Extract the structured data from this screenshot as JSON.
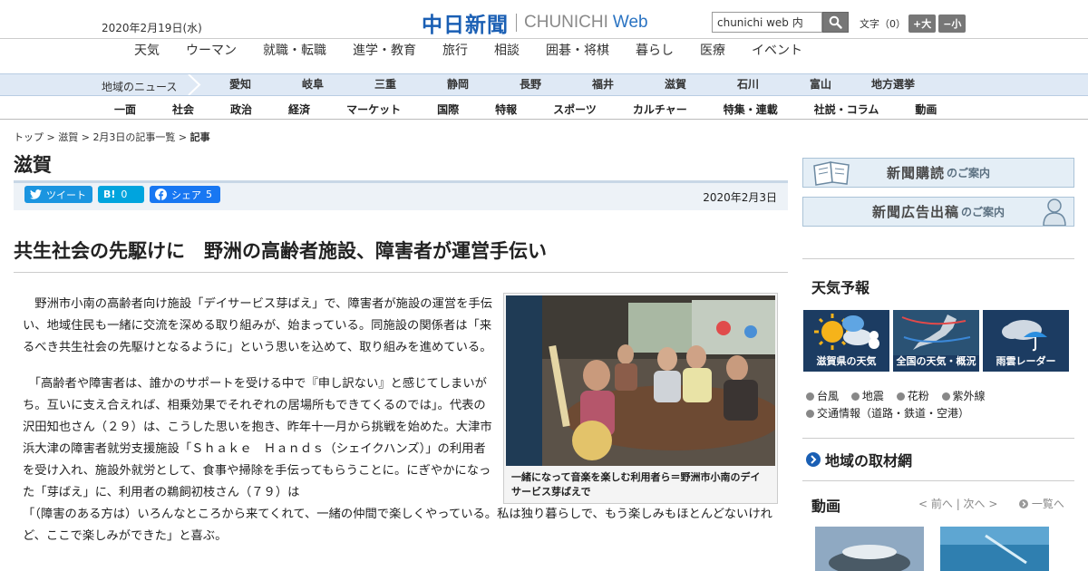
{
  "header": {
    "date": "2020年2月19日(水)",
    "logo_jp": "中日新聞",
    "logo_en": "CHUNICHI",
    "logo_web": "Web",
    "search_value": "chunichi web 内",
    "font_label": "文字（0）",
    "font_bigger": "+大",
    "font_smaller": "−小"
  },
  "category_nav": [
    "天気",
    "ウーマン",
    "就職・転職",
    "進学・教育",
    "旅行",
    "相談",
    "囲碁・将棋",
    "暮らし",
    "医療",
    "イベント"
  ],
  "region_nav": {
    "heading": "地域のニュース",
    "items": [
      "愛知",
      "岐阜",
      "三重",
      "静岡",
      "長野",
      "福井",
      "滋賀",
      "石川",
      "富山",
      "地方選挙"
    ]
  },
  "section_nav": [
    "一面",
    "社会",
    "政治",
    "経済",
    "マーケット",
    "国際",
    "特報",
    "スポーツ",
    "カルチャー",
    "特集・連載",
    "社説・コラム",
    "動画"
  ],
  "breadcrumb": {
    "items": [
      "トップ",
      "滋賀",
      "2月3日の記事一覧"
    ],
    "current": "記事",
    "sep": " > "
  },
  "section_title": "滋賀",
  "share": {
    "tweet": "ツイート",
    "hatena": "B!",
    "hatena_count": "0",
    "facebook": "シェア",
    "facebook_count": "5",
    "publish_date": "2020年2月3日"
  },
  "article": {
    "headline": "共生社会の先駆けに　野洲の高齢者施設、障害者が運営手伝い",
    "p1": "　野洲市小南の高齢者向け施設「デイサービス芽ばえ」で、障害者が施設の運営を手伝い、地域住民も一緒に交流を深める取り組みが、始まっている。同施設の関係者は「来るべき共生社会の先駆けとなるように」という思いを込めて、取り組みを進めている。",
    "p2": "　「高齢者や障害者は、誰かのサポートを受ける中で『申し訳ない』と感じてしまいがち。互いに支え合えれば、相乗効果でそれぞれの居場所もできてくるのでは」。代表の沢田知也さん（２９）は、こうした思いを抱き、昨年十一月から挑戦を始めた。大津市浜大津の障害者就労支援施設「Ｓｈａｋｅ　Ｈａｎｄｓ（シェイクハンズ）」の利用者を受け入れ、施設外就労として、食事や掃除を手伝ってもらうことに。にぎやかになった「芽ばえ」に、利用者の鵜飼初枝さん（７９）は",
    "p3": "「（障害のある方は）いろんなところから来てくれて、一緒の仲間で楽しくやっている。私は独り暮らしで、もう楽しみもほとんどないけれど、ここで楽しみができた」と喜ぶ。",
    "photo_caption": "一緒になって音楽を楽しむ利用者ら＝野洲市小南のデイサービス芽ばえで"
  },
  "sidebar": {
    "banner1_main": "新聞購読",
    "banner1_sub": "のご案内",
    "banner2_main": "新聞広告出稿",
    "banner2_sub": "のご案内",
    "weather_title": "天気予報",
    "weather_tiles": [
      "滋賀県の天気",
      "全国の天気・概況",
      "雨雲レーダー"
    ],
    "weather_links": [
      "台風",
      "地震",
      "花粉",
      "紫外線"
    ],
    "traffic_link": "交通情報（道路・鉄道・空港）",
    "region_title": "地域の取材網",
    "video_title": "動画",
    "video_prev": "< 前へ",
    "video_next": "次へ >",
    "video_list": "一覧へ"
  },
  "colors": {
    "brand_blue": "#1a5fb4",
    "region_bg": "#dfe9f5",
    "twitter": "#1b95e0",
    "hatena": "#00a4de",
    "facebook": "#1877f2"
  }
}
